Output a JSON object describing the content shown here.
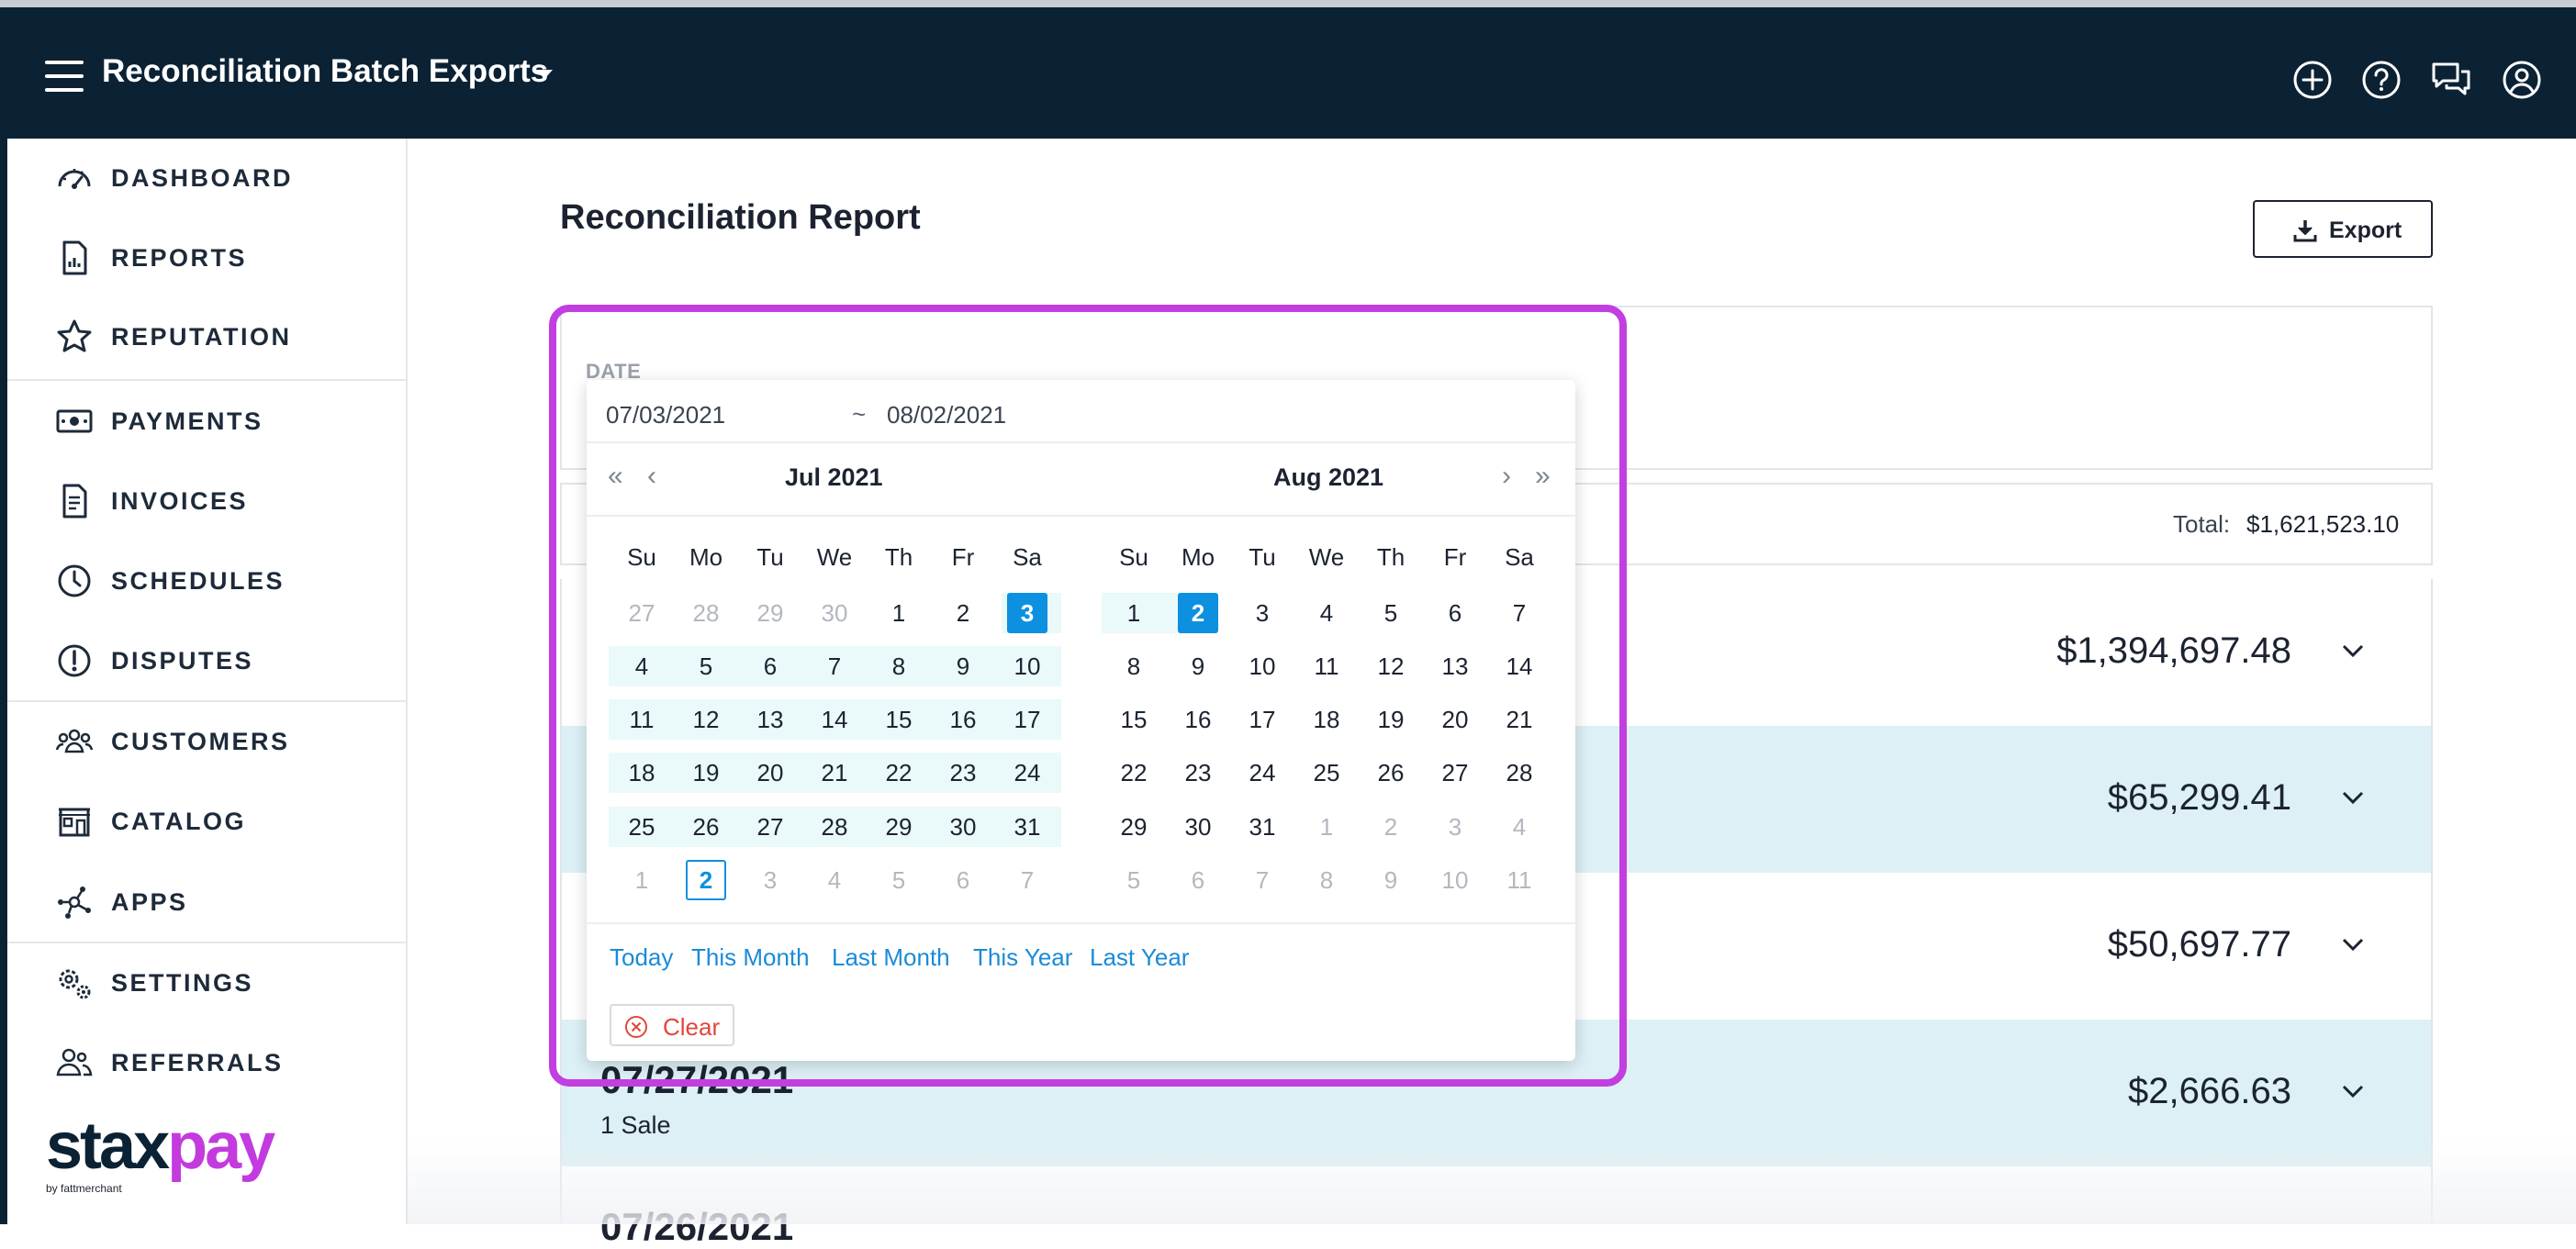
{
  "header": {
    "title": "Reconciliation Batch Exports",
    "icons": [
      "menu-icon",
      "caret-down-icon",
      "add-circle-icon",
      "help-icon",
      "chat-icon",
      "account-icon"
    ]
  },
  "sidebar": {
    "items": [
      {
        "label": "DASHBOARD",
        "icon": "gauge-icon"
      },
      {
        "label": "REPORTS",
        "icon": "report-icon"
      },
      {
        "label": "REPUTATION",
        "icon": "star-icon"
      },
      {
        "label": "PAYMENTS",
        "icon": "money-icon"
      },
      {
        "label": "INVOICES",
        "icon": "invoice-icon"
      },
      {
        "label": "SCHEDULES",
        "icon": "clock-icon"
      },
      {
        "label": "DISPUTES",
        "icon": "alert-icon"
      },
      {
        "label": "CUSTOMERS",
        "icon": "users-icon"
      },
      {
        "label": "CATALOG",
        "icon": "store-icon"
      },
      {
        "label": "APPS",
        "icon": "nodes-icon"
      },
      {
        "label": "SETTINGS",
        "icon": "gears-icon"
      },
      {
        "label": "REFERRALS",
        "icon": "referral-icon"
      }
    ],
    "logo": {
      "part1": "stax",
      "part2": "pay",
      "sub": "by fattmerchant"
    }
  },
  "main": {
    "title": "Reconciliation Report",
    "export_label": "Export",
    "date_label": "DATE",
    "total_label": "Total:",
    "total_value": "$1,621,523.10",
    "rows": [
      {
        "date": "",
        "sub": "",
        "amount": "$1,394,697.48"
      },
      {
        "date": "",
        "sub": "",
        "amount": "$65,299.41"
      },
      {
        "date": "",
        "sub": "",
        "amount": "$50,697.77"
      },
      {
        "date": "07/27/2021",
        "sub": "1 Sale",
        "amount": "$2,666.63"
      },
      {
        "date": "07/26/2021",
        "sub": "",
        "amount": ""
      }
    ]
  },
  "datepicker": {
    "start": "07/03/2021",
    "separator": "~",
    "end": "08/02/2021",
    "nav": {
      "prev_year": "«",
      "prev_month": "‹",
      "next_month": "›",
      "next_year": "»"
    },
    "weekdays": [
      "Su",
      "Mo",
      "Tu",
      "We",
      "Th",
      "Fr",
      "Sa"
    ],
    "left": {
      "title": "Jul 2021",
      "days": [
        27,
        28,
        29,
        30,
        1,
        2,
        3,
        4,
        5,
        6,
        7,
        8,
        9,
        10,
        11,
        12,
        13,
        14,
        15,
        16,
        17,
        18,
        19,
        20,
        21,
        22,
        23,
        24,
        25,
        26,
        27,
        28,
        29,
        30,
        31,
        1,
        2,
        3,
        4,
        5,
        6,
        7
      ]
    },
    "right": {
      "title": "Aug 2021",
      "days": [
        1,
        2,
        3,
        4,
        5,
        6,
        7,
        8,
        9,
        10,
        11,
        12,
        13,
        14,
        15,
        16,
        17,
        18,
        19,
        20,
        21,
        22,
        23,
        24,
        25,
        26,
        27,
        28,
        29,
        30,
        31,
        1,
        2,
        3,
        4,
        5,
        6,
        7,
        8,
        9,
        10,
        11
      ]
    },
    "presets": [
      "Today",
      "This Month",
      "Last Month",
      "This Year",
      "Last Year"
    ],
    "clear_label": "Clear"
  },
  "colors": {
    "header_bg": "#0b2234",
    "accent_blue": "#0d90e0",
    "range_band": "#eaf9fa",
    "row_alt": "#dcf0f5",
    "highlight": "#c23ee0",
    "clear_red": "#e2463c"
  }
}
